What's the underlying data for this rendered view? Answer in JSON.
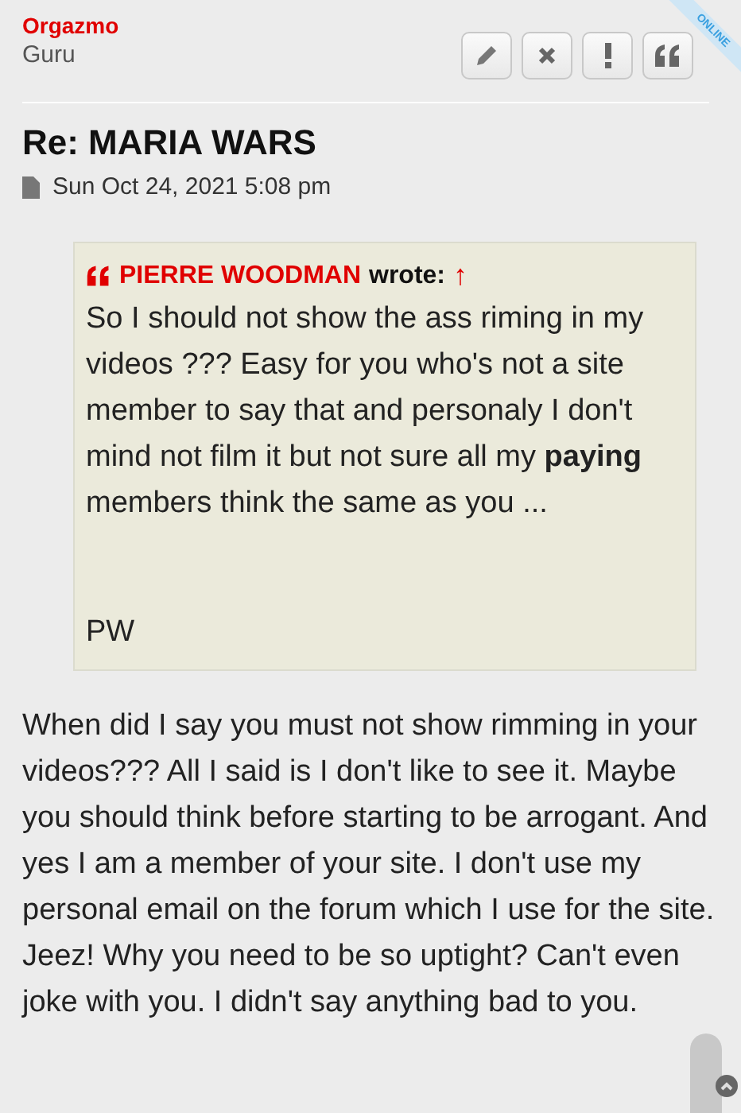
{
  "author": {
    "name": "Orgazmo",
    "rank": "Guru",
    "online_badge": "ONLINE"
  },
  "post": {
    "title": "Re: MARIA WARS",
    "date": "Sun Oct 24, 2021 5:08 pm",
    "quote": {
      "author": "PIERRE WOODMAN",
      "wrote": "wrote:",
      "arrow": "↑",
      "text": "So I should not show the ass riming in my videos ??? Easy for you who's not a site member to say that and personaly I don't mind not film it but not sure all my **paying** members think the same as you ...",
      "signature": "PW"
    },
    "body": "When did I say you must not show rimming in your videos??? All I said is I don't like to see it. Maybe you should think before starting to be arrogant. And yes I am a member of your site. I don't use my personal email on the forum which I use for the site. Jeez! Why you need to be so uptight? Can't even joke with you. I didn't say anything bad to you."
  }
}
